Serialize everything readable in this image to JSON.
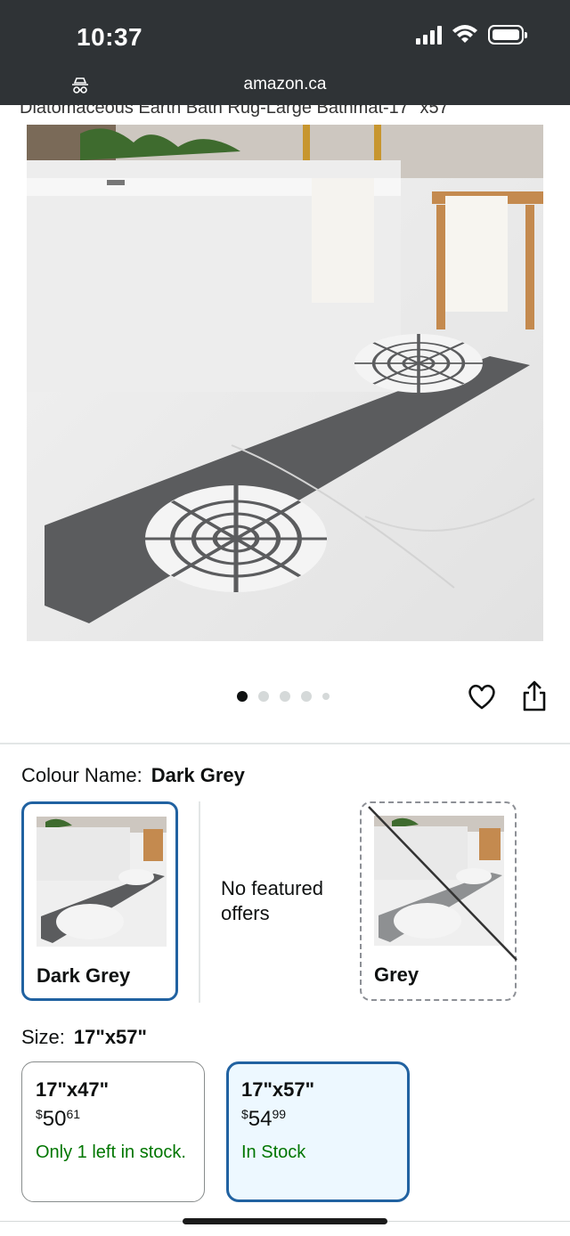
{
  "status_bar": {
    "time": "10:37"
  },
  "browser": {
    "url": "amazon.ca"
  },
  "product": {
    "clipped_title": "Diatomaceous Earth Bath Rug-Large Bathmat-17\" x57\"",
    "image_count": 5,
    "active_image": 1
  },
  "colour": {
    "label": "Colour Name:",
    "selected": "Dark Grey",
    "options": [
      {
        "name": "Dark Grey",
        "state": "selected"
      },
      {
        "name": "",
        "note": "No featured offers"
      },
      {
        "name": "Grey",
        "state": "unavailable"
      }
    ]
  },
  "size": {
    "label": "Size:",
    "selected": "17\"x57\"",
    "options": [
      {
        "name": "17\"x47\"",
        "currency": "$",
        "dollars": "50",
        "cents": "61",
        "availability": "Only 1 left in stock."
      },
      {
        "name": "17\"x57\"",
        "currency": "$",
        "dollars": "54",
        "cents": "99",
        "availability": "In Stock"
      }
    ]
  },
  "icons": [
    "incognito-icon",
    "signal-icon",
    "wifi-icon",
    "battery-icon",
    "heart-icon",
    "share-icon"
  ],
  "colors": {
    "chrome": "#2f3336",
    "selected_border": "#2162a1",
    "in_stock": "#007600",
    "mat": "#5b5c5e"
  }
}
